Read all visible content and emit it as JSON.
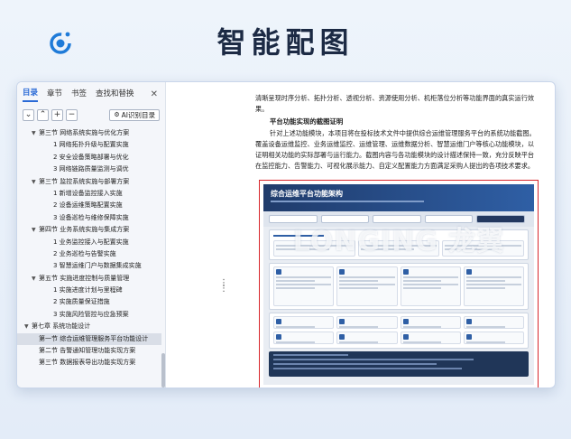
{
  "page": {
    "heading": "智能配图"
  },
  "panel": {
    "tabs": [
      {
        "label": "目录",
        "active": true
      },
      {
        "label": "章节",
        "active": false
      },
      {
        "label": "书签",
        "active": false
      },
      {
        "label": "查找和替换",
        "active": false
      }
    ],
    "close_glyph": "✕",
    "toolbar": {
      "collapse": "⌄",
      "expand": "⌃",
      "add": "+",
      "remove": "−",
      "ai_label": "AI识别目录"
    },
    "toc": [
      {
        "label": "第三节 网络系统实施与优化方案",
        "level": 2,
        "expandable": true
      },
      {
        "label": "1 网络拓扑升级与配置实施",
        "level": 3
      },
      {
        "label": "2 安全设备策略部署与优化",
        "level": 3
      },
      {
        "label": "3 网络链路质量监测与调优",
        "level": 3
      },
      {
        "label": "第三节 监控系统实施与部署方案",
        "level": 2,
        "expandable": true
      },
      {
        "label": "1 新增设备监控接入实施",
        "level": 3
      },
      {
        "label": "2 设备运维策略配置实施",
        "level": 3
      },
      {
        "label": "3 设备巡检与维修保障实施",
        "level": 3
      },
      {
        "label": "第四节 业务系统实施与集成方案",
        "level": 2,
        "expandable": true
      },
      {
        "label": "1 业务监控接入与配置实施",
        "level": 3
      },
      {
        "label": "2 业务巡检与告警实施",
        "level": 3
      },
      {
        "label": "3 智慧运维门户与数据集成实施",
        "level": 3
      },
      {
        "label": "第五节 实施进度控制与质量管理",
        "level": 2,
        "expandable": true
      },
      {
        "label": "1 实施进度计划与里程碑",
        "level": 3
      },
      {
        "label": "2 实施质量保证措施",
        "level": 3
      },
      {
        "label": "3 实施风险管控与应急预案",
        "level": 3
      },
      {
        "label": "第七章 系统功能设计",
        "level": 1,
        "expandable": true
      },
      {
        "label": "第一节 综合运维管理服务平台功能设计",
        "level": 2,
        "selected": true
      },
      {
        "label": "第二节 告警通知管理功能实现方案",
        "level": 2
      },
      {
        "label": "第三节 数据报表导出功能实现方案",
        "level": 2
      }
    ]
  },
  "doc": {
    "para1": "清晰呈现时序分析、拓扑分析、透视分析、资源使用分析、机柜落位分析等功能界面的真实运行效果。",
    "heading": "平台功能实现的截图证明",
    "para2": "针对上述功能模块，本项目将在投标技术文件中提供综合运维管理服务平台的系统功能截图。覆盖设备运维监控、业务运维监控、运维管理、运维数据分析、智慧运维门户等核心功能模块，以证明相关功能的实际部署与运行能力。截图内容与各功能模块的设计描述保持一致，充分反映平台在监控能力、告警能力、可视化展示能力、自定义配置能力方面满足采购人提出的各项技术要求。",
    "figure": {
      "title": "综合运维平台功能架构",
      "watermark": "LONGING 龙翼"
    }
  },
  "colors": {
    "accent": "#2a6ad6",
    "frame": "#d8252b",
    "fig_header": "#1f3b6b"
  }
}
